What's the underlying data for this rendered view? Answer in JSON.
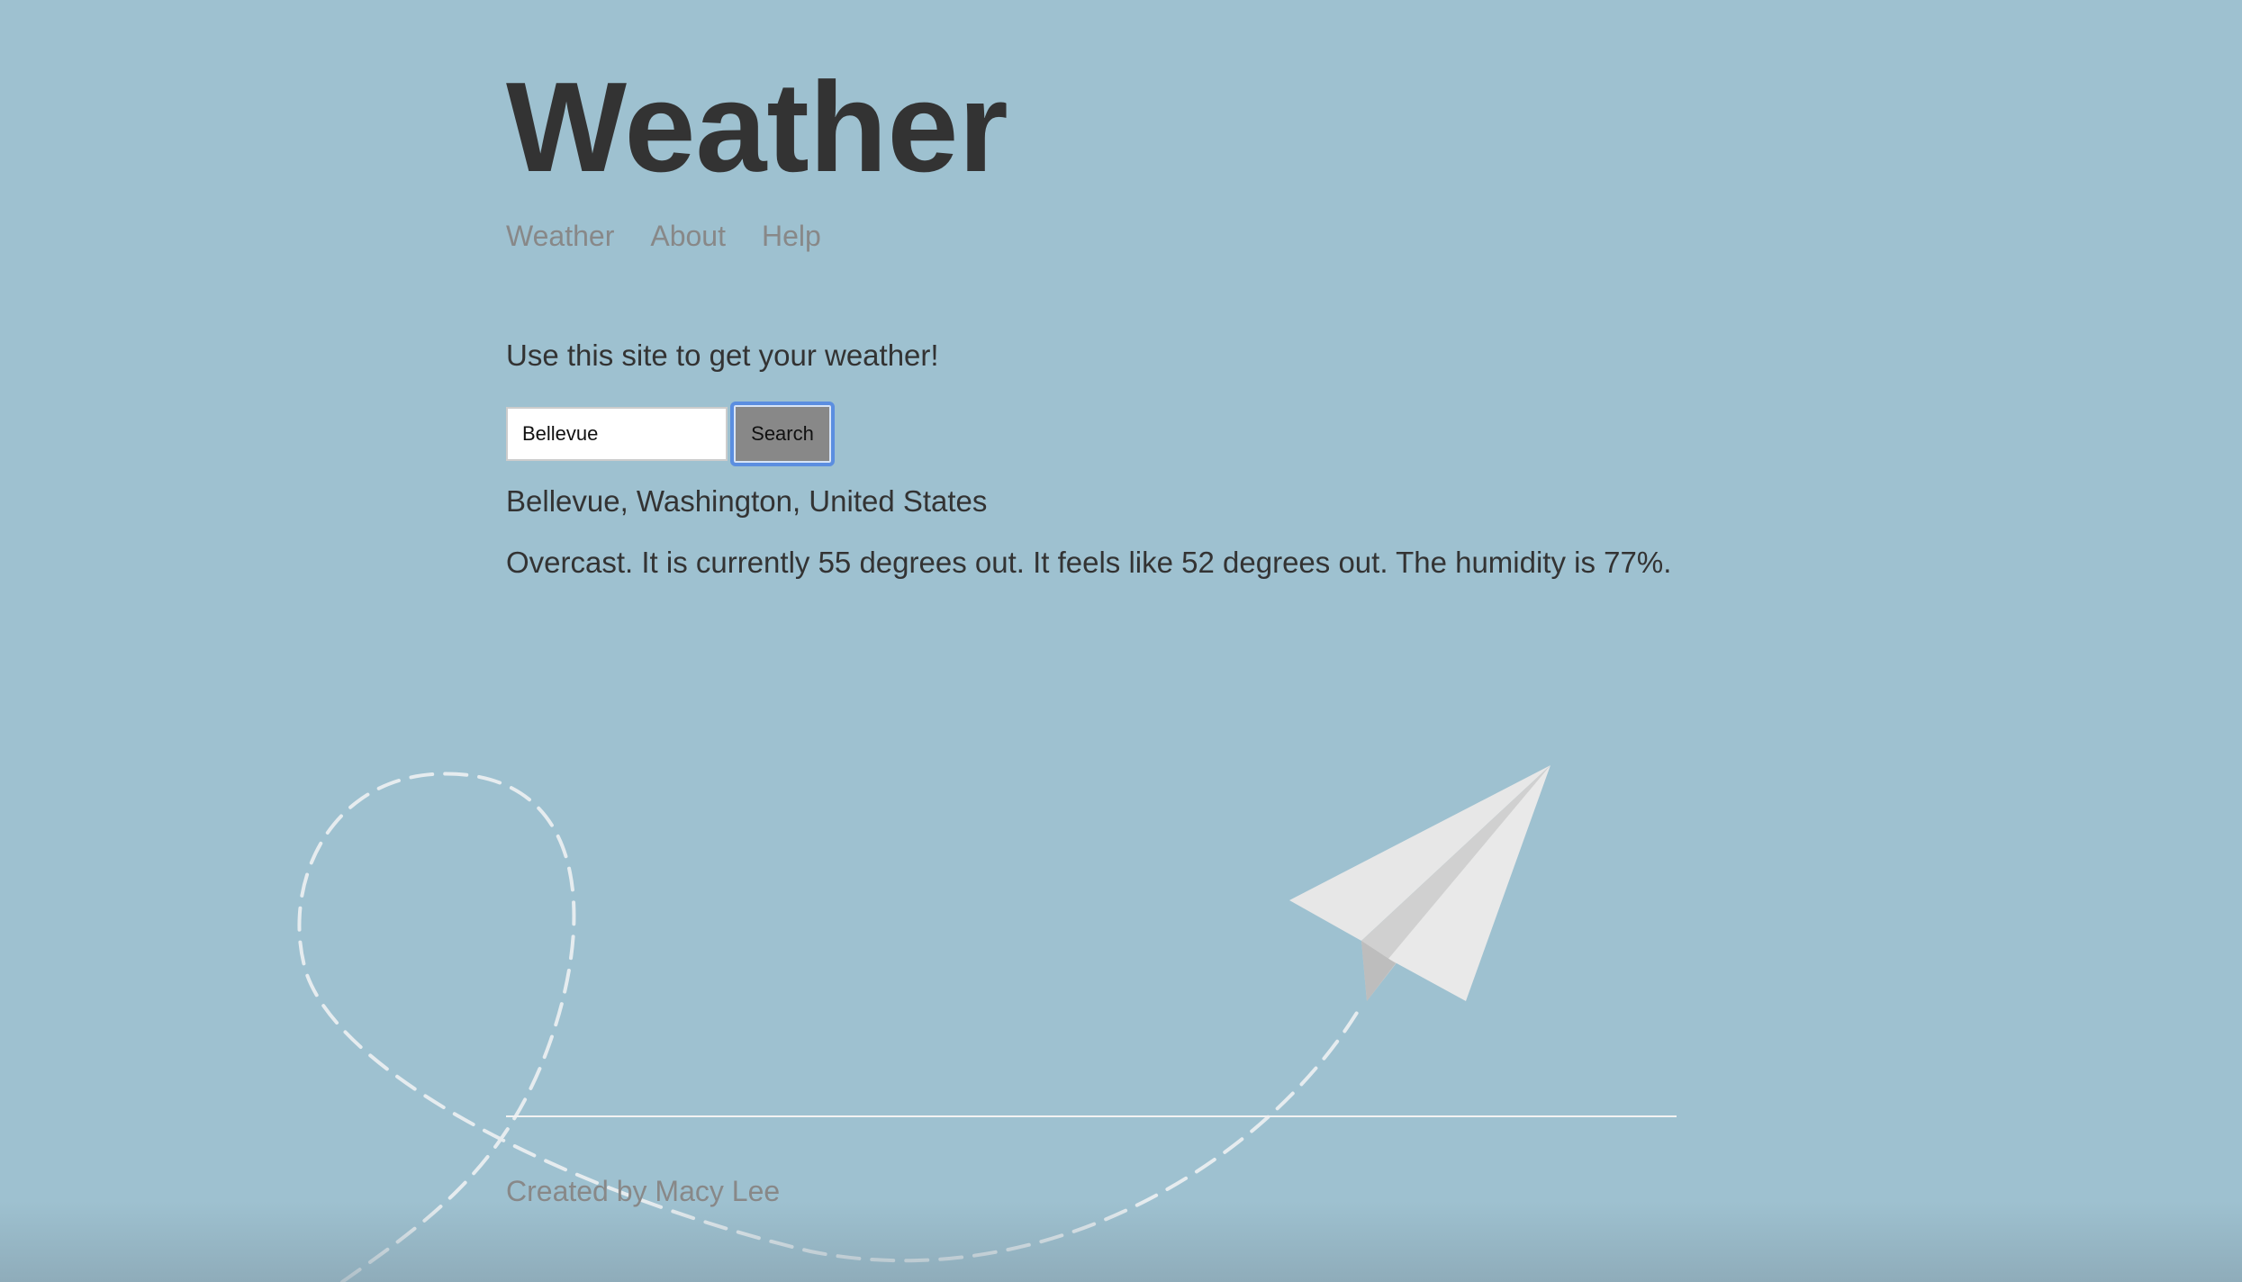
{
  "header": {
    "title": "Weather"
  },
  "nav": {
    "items": [
      {
        "label": "Weather"
      },
      {
        "label": "About"
      },
      {
        "label": "Help"
      }
    ]
  },
  "main": {
    "intro": "Use this site to get your weather!",
    "search": {
      "value": "Bellevue",
      "button_label": "Search"
    },
    "result": {
      "location": "Bellevue, Washington, United States",
      "forecast": "Overcast. It is currently 55 degrees out. It feels like 52 degrees out. The humidity is 77%."
    }
  },
  "footer": {
    "credit": "Created by Macy Lee"
  },
  "colors": {
    "background": "#9ec1d0",
    "text": "#333333",
    "muted_text": "#888888",
    "button_bg": "#888888",
    "focus_ring": "#5b8ee0"
  },
  "illustration": {
    "name": "paper-plane-with-dashed-flight-path"
  }
}
